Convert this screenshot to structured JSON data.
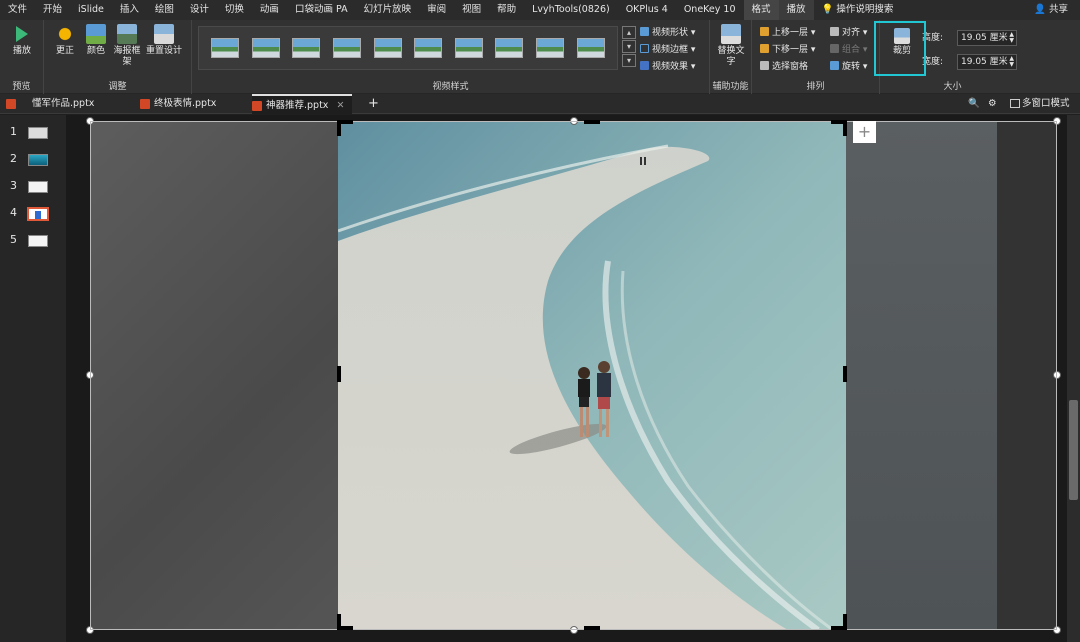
{
  "menu": {
    "items": [
      "文件",
      "开始",
      "iSlide",
      "插入",
      "绘图",
      "设计",
      "切换",
      "动画",
      "口袋动画 PA",
      "幻灯片放映",
      "审阅",
      "视图",
      "帮助",
      "LvyhTools(0826)",
      "OKPlus 4",
      "OneKey 10",
      "格式",
      "播放"
    ],
    "search": "操作说明搜索",
    "share": "共享"
  },
  "ribbon": {
    "preview": {
      "play": "播放",
      "group": "预览"
    },
    "adjust": {
      "correct": "更正",
      "color": "颜色",
      "poster": "海报框架",
      "reset": "重置设计",
      "group": "调整"
    },
    "video_style": {
      "shape": "视频形状",
      "border": "视频边框",
      "effect": "视频效果",
      "group": "视频样式"
    },
    "accessibility": {
      "alt_text": "替换文字",
      "group": "辅助功能"
    },
    "arrange": {
      "bring_forward": "上移一层",
      "send_backward": "下移一层",
      "selection_pane": "选择窗格",
      "align": "对齐",
      "group_btn": "组合",
      "rotate": "旋转",
      "group": "排列"
    },
    "size": {
      "crop": "裁剪",
      "height_label": "高度:",
      "height_value": "19.05 厘米",
      "width_label": "宽度:",
      "width_value": "19.05 厘米",
      "group": "大小"
    }
  },
  "tabs": {
    "docs": [
      "懂军作品.pptx",
      "终极表情.pptx",
      "神器推荐.pptx"
    ],
    "add": "+",
    "multiwin": "多窗口模式"
  },
  "slides": [
    "1",
    "2",
    "3",
    "4",
    "5"
  ],
  "colors": {
    "accent": "#21c7d2",
    "ppt": "#d24726"
  }
}
